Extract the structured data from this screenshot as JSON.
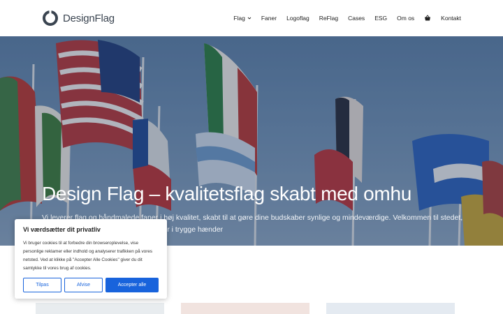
{
  "brand": {
    "name_light": "Design",
    "name_bold": "Flag",
    "accent": "#3a4450"
  },
  "nav": {
    "items": [
      {
        "label": "Flag",
        "has_dropdown": true
      },
      {
        "label": "Faner"
      },
      {
        "label": "Logoflag"
      },
      {
        "label": "ReFlag"
      },
      {
        "label": "Cases"
      },
      {
        "label": "ESG"
      },
      {
        "label": "Om os"
      }
    ],
    "cart_icon": "basket-icon",
    "contact_label": "Kontakt"
  },
  "hero": {
    "title": "Design Flag – kvalitetsflag skabt med omhu",
    "text": "Vi leverer flag og håndmalede faner i høj kvalitet, skabt til at gøre dine budskaber synlige og mindeværdige. Velkommen til stedet, hvor din identitet og dit budskab altid er i trygge hænder"
  },
  "cookie": {
    "title": "Vi værdsætter dit privatliv",
    "body": "Vi bruger cookies til at forbedre din browseroplevelse, vise personlige reklamer eller indhold og analyserer trafikken på vores netsted. Ved at klikke på \"Accepter Alle Cookies\" giver du dit samtykke til vores brug af cookies.",
    "customize_label": "Tilpas",
    "reject_label": "Afvise",
    "accept_label": "Accepter alle",
    "button_color": "#1863dc"
  }
}
